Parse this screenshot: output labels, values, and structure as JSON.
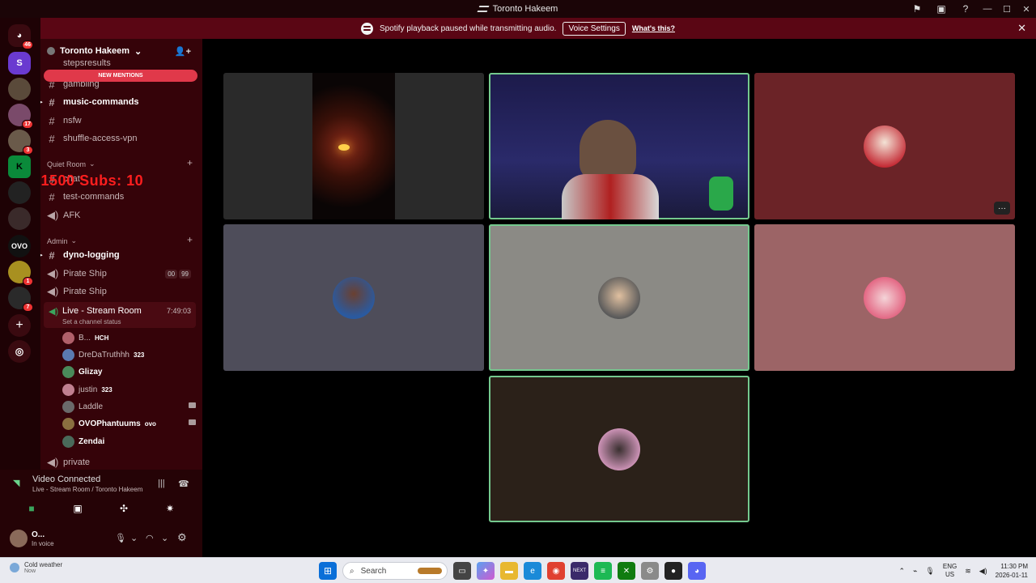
{
  "window": {
    "title": "Toronto Hakeem"
  },
  "notice": {
    "message": "Spotify playback paused while transmitting audio.",
    "voice_settings": "Voice Settings",
    "whats_this": "What's this?"
  },
  "rail": {
    "badges": [
      "46",
      "17",
      "3",
      "1",
      "7"
    ]
  },
  "server": {
    "name": "Toronto Hakeem",
    "new_mentions": "NEW MENTIONS",
    "overlay_text": "60/1500  Subs: 10",
    "channels_top": [
      {
        "name": "stepsresults"
      },
      {
        "name": "gambling"
      },
      {
        "name": "music-commands"
      },
      {
        "name": "nsfw"
      },
      {
        "name": "shuffle-access-vpn"
      }
    ],
    "category_quiet": "Quiet Room",
    "channels_quiet": [
      {
        "name": "chat"
      },
      {
        "name": "test-commands"
      },
      {
        "name": "AFK"
      }
    ],
    "category_admin": "Admin",
    "channels_admin": [
      {
        "name": "dyno-logging"
      },
      {
        "name": "Pirate Ship",
        "pill1": "00",
        "pill2": "99"
      },
      {
        "name": "Pirate Ship"
      }
    ],
    "live_room": {
      "name": "Live - Stream Room",
      "time": "7:49:03",
      "status": "Set a channel status"
    },
    "voice_users": [
      {
        "name": "B...",
        "tag": "HCH",
        "color": "#b0606a"
      },
      {
        "name": "DreDaTruthhh",
        "tag": "323",
        "color": "#5a7ab0"
      },
      {
        "name": "Glizay",
        "tag": "",
        "color": "#4a8a5a"
      },
      {
        "name": "justin",
        "tag": "323",
        "color": "#c08090"
      },
      {
        "name": "Laddle",
        "tag": "",
        "color": "#6a6a6a"
      },
      {
        "name": "OVOPhantuums",
        "tag": "ovo",
        "color": "#8a7040"
      },
      {
        "name": "Zendai",
        "tag": "",
        "color": "#4a6a5a"
      }
    ],
    "private": "private"
  },
  "voice_panel": {
    "title": "Video Connected",
    "subtitle": "Live - Stream Room / Toronto Hakeem"
  },
  "me": {
    "name": "O...",
    "status": "In voice"
  },
  "taskbar": {
    "weather_title": "Cold weather",
    "weather_sub": "Now",
    "search": "Search",
    "lang1": "ENG",
    "lang2": "US",
    "time": "11:30 PM",
    "date": "2026-01-11"
  },
  "colors": {
    "accent_red": "#e0394a",
    "speaking_green": "#74c98e",
    "sidebar": "#350309"
  }
}
